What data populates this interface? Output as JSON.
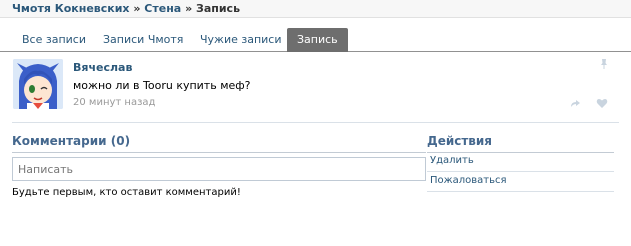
{
  "breadcrumb": {
    "part1": "Чмотя Кокневских",
    "sep1": " » ",
    "part2": "Стена",
    "sep2": " » ",
    "current": "Запись"
  },
  "tabs": [
    {
      "label": "Все записи"
    },
    {
      "label": "Записи Чмотя"
    },
    {
      "label": "Чужие записи"
    },
    {
      "label": "Запись"
    }
  ],
  "post": {
    "author": "Вячеслав",
    "text": "можно ли в Tooru купить меф?",
    "time": "20 минут назад"
  },
  "comments": {
    "title": "Комментарии (0)",
    "input_placeholder": "Написать",
    "empty_note": "Будьте первым, кто оставит комментарий!"
  },
  "actions": {
    "title": "Действия",
    "items": [
      {
        "label": "Удалить"
      },
      {
        "label": "Пожаловаться"
      }
    ]
  },
  "colors": {
    "link": "#2b587a",
    "header": "#45688e",
    "active_tab": "#6e6e6e"
  },
  "icons": [
    "avatar-image",
    "pin-icon",
    "share-icon",
    "heart-icon"
  ]
}
